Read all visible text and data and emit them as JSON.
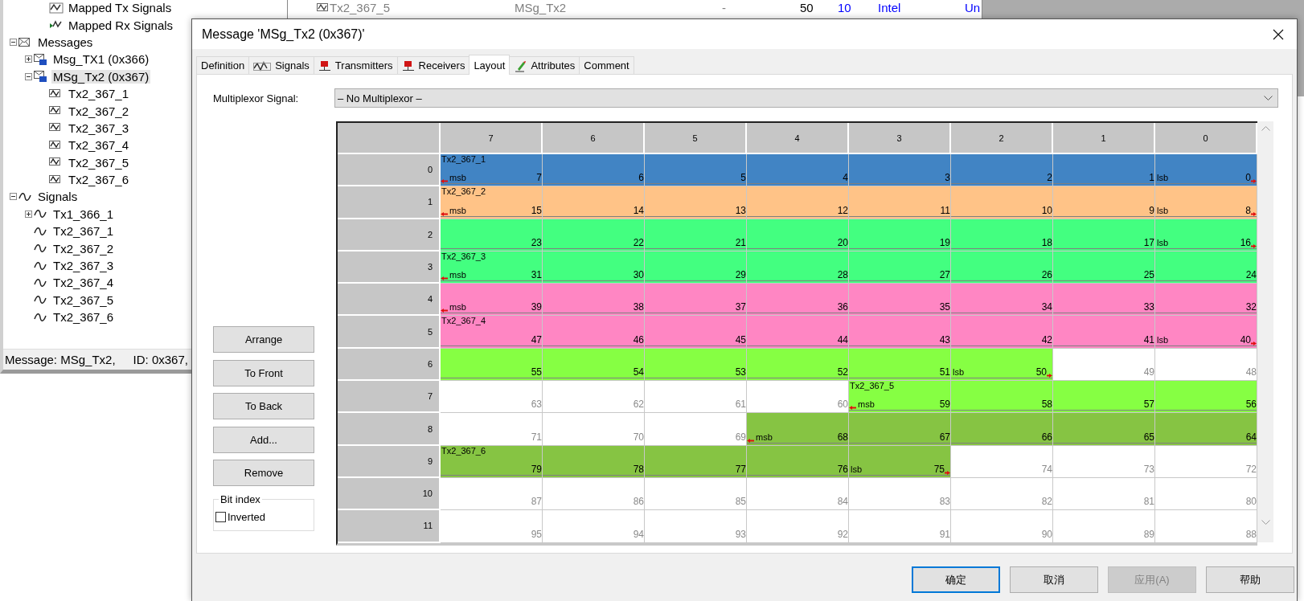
{
  "tree": {
    "cut_items": [
      {
        "label": "Mapped Tx Signals",
        "kind": "mapped-tx",
        "selected": false
      },
      {
        "label": "Mapped Rx Signals",
        "kind": "mapped-rx",
        "selected": false
      }
    ],
    "items": [
      {
        "label": "Messages",
        "kind": "folder",
        "expanded": true,
        "selected": false,
        "children": [
          {
            "label": "Msg_TX1 (0x366)",
            "kind": "message",
            "expanded": false,
            "selected": false
          },
          {
            "label": "MSg_Tx2 (0x367)",
            "kind": "message",
            "expanded": true,
            "selected": true,
            "children": [
              {
                "label": "Tx2_367_1",
                "kind": "message-signal",
                "selected": false
              },
              {
                "label": "Tx2_367_2",
                "kind": "message-signal",
                "selected": false
              },
              {
                "label": "Tx2_367_3",
                "kind": "message-signal",
                "selected": false
              },
              {
                "label": "Tx2_367_4",
                "kind": "message-signal",
                "selected": false
              },
              {
                "label": "Tx2_367_5",
                "kind": "message-signal",
                "selected": false
              },
              {
                "label": "Tx2_367_6",
                "kind": "message-signal",
                "selected": false
              }
            ]
          }
        ]
      },
      {
        "label": "Signals",
        "kind": "signal",
        "expanded": true,
        "selected": false,
        "children": [
          {
            "label": "Tx1_366_1",
            "kind": "signal",
            "expanded": false,
            "selected": false
          },
          {
            "label": "Tx2_367_1",
            "kind": "signal",
            "selected": false
          },
          {
            "label": "Tx2_367_2",
            "kind": "signal",
            "selected": false
          },
          {
            "label": "Tx2_367_3",
            "kind": "signal",
            "selected": false
          },
          {
            "label": "Tx2_367_4",
            "kind": "signal",
            "selected": false
          },
          {
            "label": "Tx2_367_5",
            "kind": "signal",
            "selected": false
          },
          {
            "label": "Tx2_367_6",
            "kind": "signal",
            "selected": false
          }
        ]
      }
    ]
  },
  "status_bar": {
    "message": "Message: MSg_Tx2,",
    "id": "ID: 0x367,"
  },
  "background_table": {
    "row": [
      {
        "text": "Tx2_367_5",
        "color": "#808080"
      },
      {
        "text": "MSg_Tx2",
        "color": "#808080"
      },
      {
        "text": "-",
        "color": "#808080"
      },
      {
        "text": "50",
        "color": "#000000"
      },
      {
        "text": "10",
        "color": "#0000ff"
      },
      {
        "text": "Intel",
        "color": "#0000ff"
      },
      {
        "text": "Un",
        "color": "#0000ff"
      }
    ]
  },
  "dialog": {
    "title": "Message 'MSg_Tx2 (0x367)'",
    "tabs": [
      {
        "label": "Definition",
        "kind": "plain",
        "selected": false
      },
      {
        "label": "Signals",
        "kind": "signal",
        "selected": false
      },
      {
        "label": "Transmitters",
        "kind": "node",
        "selected": false
      },
      {
        "label": "Receivers",
        "kind": "node",
        "selected": false
      },
      {
        "label": "Layout",
        "kind": "plain",
        "selected": true
      },
      {
        "label": "Attributes",
        "kind": "attribute",
        "selected": false
      },
      {
        "label": "Comment",
        "kind": "plain",
        "selected": false
      }
    ],
    "multiplexor": {
      "label": "Multiplexor Signal:",
      "value": "– No Multiplexor –"
    },
    "side_buttons": [
      [
        "Arrange"
      ],
      [
        "To Front",
        "To Back"
      ],
      [
        "Add...",
        "Remove"
      ]
    ],
    "bit_index": {
      "title": "Bit index",
      "inverted": {
        "label": "Inverted",
        "checked": false
      }
    },
    "grid": {
      "columns": [
        "7",
        "6",
        "5",
        "4",
        "3",
        "2",
        "1",
        "0"
      ],
      "rows": [
        {
          "index": "0",
          "cells": [
            {
              "bit": "7",
              "color": "#4184c4",
              "label": "Tx2_367_1",
              "tag": "msb"
            },
            {
              "bit": "6",
              "color": "#4184c4"
            },
            {
              "bit": "5",
              "color": "#4184c4"
            },
            {
              "bit": "4",
              "color": "#4184c4"
            },
            {
              "bit": "3",
              "color": "#4184c4"
            },
            {
              "bit": "2",
              "color": "#4184c4"
            },
            {
              "bit": "1",
              "color": "#4184c4"
            },
            {
              "bit": "0",
              "color": "#4184c4",
              "tag": "lsb"
            }
          ]
        },
        {
          "index": "1",
          "cells": [
            {
              "bit": "15",
              "color": "#ffc387",
              "label": "Tx2_367_2",
              "tag": "msb"
            },
            {
              "bit": "14",
              "color": "#ffc387"
            },
            {
              "bit": "13",
              "color": "#ffc387"
            },
            {
              "bit": "12",
              "color": "#ffc387"
            },
            {
              "bit": "11",
              "color": "#ffc387"
            },
            {
              "bit": "10",
              "color": "#ffc387"
            },
            {
              "bit": "9",
              "color": "#ffc387"
            },
            {
              "bit": "8",
              "color": "#ffc387",
              "tag": "lsb"
            }
          ]
        },
        {
          "index": "2",
          "cells": [
            {
              "bit": "23",
              "color": "#43ff80"
            },
            {
              "bit": "22",
              "color": "#43ff80"
            },
            {
              "bit": "21",
              "color": "#43ff80"
            },
            {
              "bit": "20",
              "color": "#43ff80"
            },
            {
              "bit": "19",
              "color": "#43ff80"
            },
            {
              "bit": "18",
              "color": "#43ff80"
            },
            {
              "bit": "17",
              "color": "#43ff80"
            },
            {
              "bit": "16",
              "color": "#43ff80",
              "tag": "lsb"
            }
          ]
        },
        {
          "index": "3",
          "cells": [
            {
              "bit": "31",
              "color": "#43ff80",
              "label": "Tx2_367_3",
              "tag": "msb"
            },
            {
              "bit": "30",
              "color": "#43ff80"
            },
            {
              "bit": "29",
              "color": "#43ff80"
            },
            {
              "bit": "28",
              "color": "#43ff80"
            },
            {
              "bit": "27",
              "color": "#43ff80"
            },
            {
              "bit": "26",
              "color": "#43ff80"
            },
            {
              "bit": "25",
              "color": "#43ff80"
            },
            {
              "bit": "24",
              "color": "#43ff80"
            }
          ]
        },
        {
          "index": "4",
          "cells": [
            {
              "bit": "39",
              "color": "#ff86c3",
              "tag": "msb"
            },
            {
              "bit": "38",
              "color": "#ff86c3"
            },
            {
              "bit": "37",
              "color": "#ff86c3"
            },
            {
              "bit": "36",
              "color": "#ff86c3"
            },
            {
              "bit": "35",
              "color": "#ff86c3"
            },
            {
              "bit": "34",
              "color": "#ff86c3"
            },
            {
              "bit": "33",
              "color": "#ff86c3"
            },
            {
              "bit": "32",
              "color": "#ff86c3"
            }
          ]
        },
        {
          "index": "5",
          "cells": [
            {
              "bit": "47",
              "color": "#ff86c3",
              "label": "Tx2_367_4"
            },
            {
              "bit": "46",
              "color": "#ff86c3"
            },
            {
              "bit": "45",
              "color": "#ff86c3"
            },
            {
              "bit": "44",
              "color": "#ff86c3"
            },
            {
              "bit": "43",
              "color": "#ff86c3"
            },
            {
              "bit": "42",
              "color": "#ff86c3"
            },
            {
              "bit": "41",
              "color": "#ff86c3"
            },
            {
              "bit": "40",
              "color": "#ff86c3",
              "tag": "lsb"
            }
          ]
        },
        {
          "index": "6",
          "cells": [
            {
              "bit": "55",
              "color": "#86ff43"
            },
            {
              "bit": "54",
              "color": "#86ff43"
            },
            {
              "bit": "53",
              "color": "#86ff43"
            },
            {
              "bit": "52",
              "color": "#86ff43"
            },
            {
              "bit": "51",
              "color": "#86ff43"
            },
            {
              "bit": "50",
              "color": "#86ff43",
              "tag": "lsb"
            },
            {
              "bit": "49"
            },
            {
              "bit": "48"
            }
          ]
        },
        {
          "index": "7",
          "cells": [
            {
              "bit": "63"
            },
            {
              "bit": "62"
            },
            {
              "bit": "61"
            },
            {
              "bit": "60"
            },
            {
              "bit": "59",
              "color": "#86ff43",
              "label": "Tx2_367_5",
              "tag": "msb"
            },
            {
              "bit": "58",
              "color": "#86ff43"
            },
            {
              "bit": "57",
              "color": "#86ff43"
            },
            {
              "bit": "56",
              "color": "#86ff43"
            }
          ]
        },
        {
          "index": "8",
          "cells": [
            {
              "bit": "71"
            },
            {
              "bit": "70"
            },
            {
              "bit": "69"
            },
            {
              "bit": "68",
              "color": "#86c443",
              "tag": "msb"
            },
            {
              "bit": "67",
              "color": "#86c443"
            },
            {
              "bit": "66",
              "color": "#86c443"
            },
            {
              "bit": "65",
              "color": "#86c443"
            },
            {
              "bit": "64",
              "color": "#86c443"
            }
          ]
        },
        {
          "index": "9",
          "cells": [
            {
              "bit": "79",
              "color": "#86c443",
              "label": "Tx2_367_6"
            },
            {
              "bit": "78",
              "color": "#86c443"
            },
            {
              "bit": "77",
              "color": "#86c443"
            },
            {
              "bit": "76",
              "color": "#86c443"
            },
            {
              "bit": "75",
              "color": "#86c443",
              "tag": "lsb"
            },
            {
              "bit": "74"
            },
            {
              "bit": "73"
            },
            {
              "bit": "72"
            }
          ]
        },
        {
          "index": "10",
          "cells": [
            {
              "bit": "87"
            },
            {
              "bit": "86"
            },
            {
              "bit": "85"
            },
            {
              "bit": "84"
            },
            {
              "bit": "83"
            },
            {
              "bit": "82"
            },
            {
              "bit": "81"
            },
            {
              "bit": "80"
            }
          ]
        },
        {
          "index": "11",
          "cells": [
            {
              "bit": "95"
            },
            {
              "bit": "94"
            },
            {
              "bit": "93"
            },
            {
              "bit": "92"
            },
            {
              "bit": "91"
            },
            {
              "bit": "90"
            },
            {
              "bit": "89"
            },
            {
              "bit": "88"
            }
          ]
        }
      ]
    },
    "buttons": [
      {
        "label": "确定",
        "default": true,
        "disabled": false
      },
      {
        "label": "取消",
        "default": false,
        "disabled": false
      },
      {
        "label": "应用(A)",
        "default": false,
        "disabled": true
      },
      {
        "label": "帮助",
        "default": false,
        "disabled": false
      }
    ]
  }
}
